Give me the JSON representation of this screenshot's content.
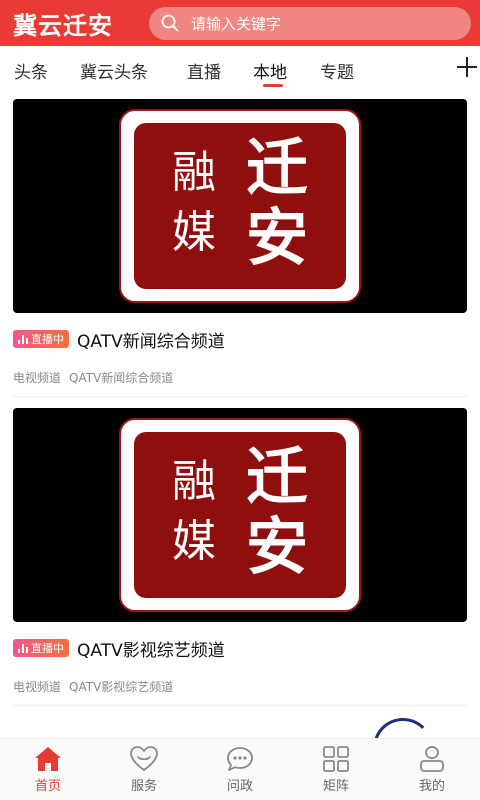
{
  "app": {
    "title": "冀云迁安",
    "accent": "#e93b36"
  },
  "search": {
    "placeholder": "请输入关键字"
  },
  "tabs": [
    {
      "label": "头条",
      "active": false
    },
    {
      "label": "冀云头条",
      "active": false
    },
    {
      "label": "直播",
      "active": false
    },
    {
      "label": "本地",
      "active": true
    },
    {
      "label": "专题",
      "active": false
    }
  ],
  "logo": {
    "chars": [
      "融",
      "媒",
      "迁",
      "安"
    ]
  },
  "feed": [
    {
      "badge": "直播中",
      "title": "QATV新闻综合频道",
      "meta": [
        "电视频道",
        "QATV新闻综合频道"
      ]
    },
    {
      "badge": "直播中",
      "title": "QATV影视综艺频道",
      "meta": [
        "电视频道",
        "QATV影视综艺频道"
      ]
    }
  ],
  "bottom_nav": [
    {
      "label": "首页",
      "icon": "home-icon",
      "active": true
    },
    {
      "label": "服务",
      "icon": "heart-icon",
      "active": false
    },
    {
      "label": "问政",
      "icon": "chat-icon",
      "active": false
    },
    {
      "label": "矩阵",
      "icon": "grid-icon",
      "active": false
    },
    {
      "label": "我的",
      "icon": "user-icon",
      "active": false
    }
  ]
}
